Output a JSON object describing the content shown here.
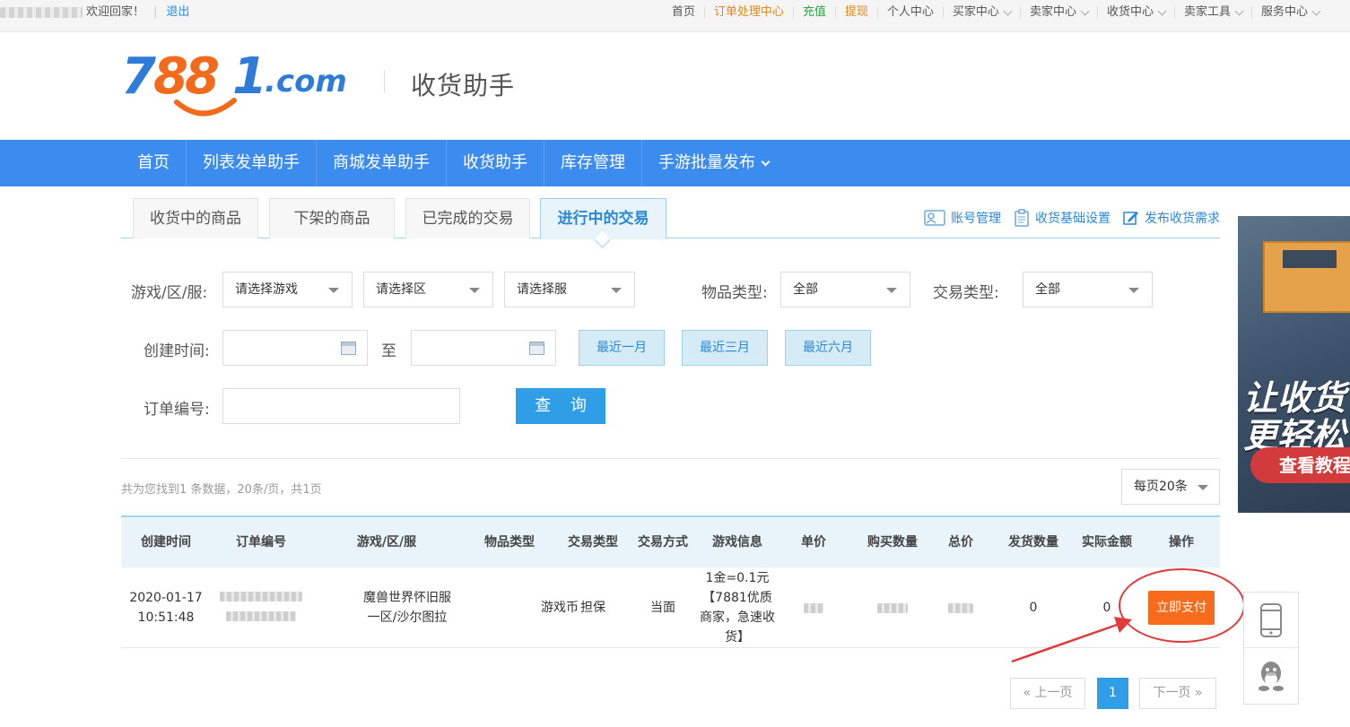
{
  "topbar": {
    "welcome": "欢迎回家！",
    "logout": "退出",
    "nav": [
      {
        "label": "首页",
        "color": "normal",
        "dropdown": false
      },
      {
        "label": "订单处理中心",
        "color": "orange",
        "dropdown": false
      },
      {
        "label": "充值",
        "color": "green",
        "dropdown": false
      },
      {
        "label": "提现",
        "color": "orange",
        "dropdown": false
      },
      {
        "label": "个人中心",
        "color": "normal",
        "dropdown": false
      },
      {
        "label": "买家中心",
        "color": "normal",
        "dropdown": true
      },
      {
        "label": "卖家中心",
        "color": "normal",
        "dropdown": true
      },
      {
        "label": "收货中心",
        "color": "normal",
        "dropdown": true
      },
      {
        "label": "卖家工具",
        "color": "normal",
        "dropdown": true
      },
      {
        "label": "服务中心",
        "color": "normal",
        "dropdown": true
      }
    ]
  },
  "header": {
    "logo_text": "7881.com",
    "subtitle": "收货助手"
  },
  "main_nav": [
    "首页",
    "列表发单助手",
    "商城发单助手",
    "收货助手",
    "库存管理",
    "手游批量发布"
  ],
  "tabs": [
    {
      "label": "收货中的商品",
      "active": false
    },
    {
      "label": "下架的商品",
      "active": false
    },
    {
      "label": "已完成的交易",
      "active": false
    },
    {
      "label": "进行中的交易",
      "active": true
    }
  ],
  "tab_links": {
    "account": "账号管理",
    "settings": "收货基础设置",
    "publish": "发布收货需求"
  },
  "filters": {
    "game_label": "游戏/区/服:",
    "game_select": "请选择游戏",
    "zone_select": "请选择区",
    "server_select": "请选择服",
    "item_type_label": "物品类型:",
    "item_type_value": "全部",
    "trade_type_label": "交易类型:",
    "trade_type_value": "全部",
    "created_label": "创建时间:",
    "to": "至",
    "last_month": "最近一月",
    "last_three_months": "最近三月",
    "last_six_months": "最近六月",
    "order_no_label": "订单编号:",
    "search": "查 询"
  },
  "summary": "共为您找到1 条数据，20条/页，共1页",
  "per_page": "每页20条",
  "table": {
    "headers": [
      "创建时间",
      "订单编号",
      "游戏/区/服",
      "物品类型",
      "交易类型",
      "交易方式",
      "游戏信息",
      "单价",
      "购买数量",
      "总价",
      "发货数量",
      "实际金额",
      "操作"
    ],
    "rows": [
      {
        "date": "2020-01-17",
        "time": "10:51:48",
        "game_line1": "魔兽世界怀旧服",
        "game_line2": "一区/沙尔图拉",
        "item_type": "游戏币",
        "trade_type": "担保",
        "trade_method": "当面",
        "game_info": "1金=0.1元【7881优质商家，急速收货】",
        "ship_qty": "0",
        "actual_amount": "0",
        "action": "立即支付"
      }
    ]
  },
  "pagination": {
    "prev": "« 上一页",
    "current": "1",
    "next": "下一页 »"
  },
  "banner": {
    "line1": "让收货",
    "line2": "更轻松",
    "button": "查看教程"
  },
  "colors": {
    "nav_blue": "#3c8cf0",
    "accent_orange": "#f76b1c",
    "link_blue": "#2a88d6",
    "annotation_red": "#e03a3a"
  }
}
